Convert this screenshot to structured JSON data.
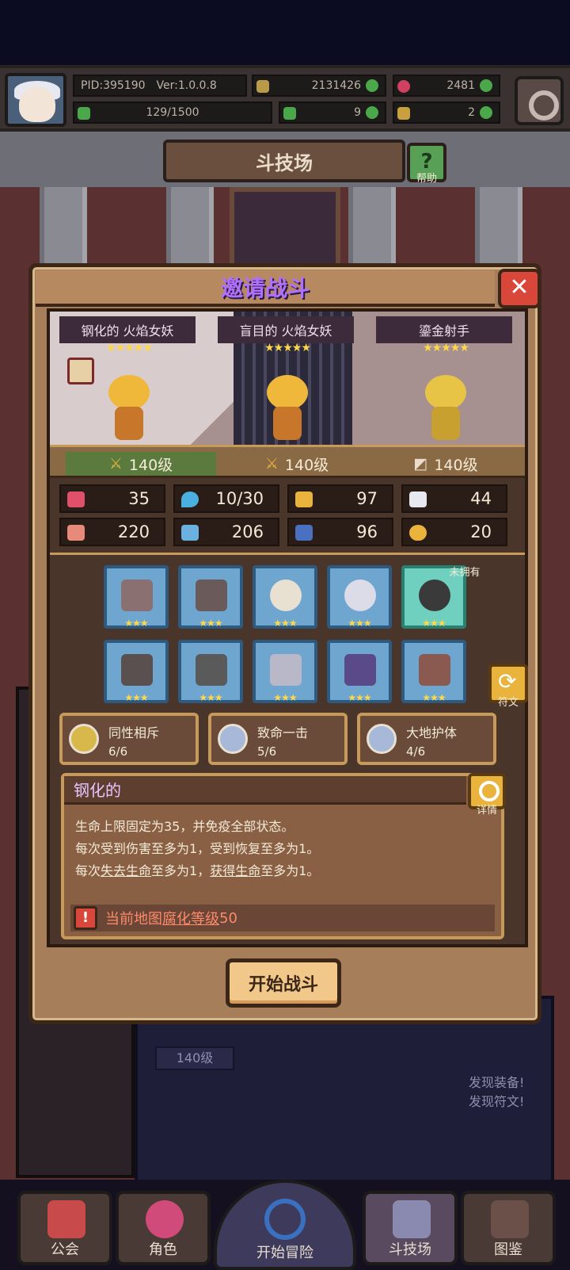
{
  "hud": {
    "pid": "PID:395190",
    "version": "Ver:1.0.0.8",
    "gold": "2131426",
    "gems": "2481",
    "stamina": "129/1500",
    "clover": "9",
    "keys": "2"
  },
  "arena": {
    "title": "斗技场",
    "help_label": "帮助"
  },
  "modal": {
    "title": "邀请战斗",
    "close": "✕",
    "heroes": [
      {
        "name": "钢化的 火焰女妖",
        "stars": "★★★★★",
        "level": "140级",
        "color": "#f0b83a"
      },
      {
        "name": "盲目的 火焰女妖",
        "stars": "★★★★★",
        "level": "140级",
        "color": "#f0b83a"
      },
      {
        "name": "鎏金射手",
        "stars": "★★★★★",
        "level": "140级",
        "color": "#e8c446"
      }
    ],
    "stats": [
      "35",
      "10/30",
      "97",
      "44",
      "220",
      "206",
      "96",
      "20"
    ],
    "unowned_label": "未拥有",
    "equip_stars": "★★★",
    "rune_label": "符文",
    "traits": [
      {
        "name": "同性相斥",
        "count": "6/6"
      },
      {
        "name": "致命一击",
        "count": "5/6"
      },
      {
        "name": "大地护体",
        "count": "4/6"
      }
    ],
    "desc": {
      "title": "钢化的",
      "detail_label": "详情",
      "line1": "生命上限固定为35，并免疫全部状态。",
      "line2": "每次受到伤害至多为1，受到恢复至多为1。",
      "line3a": "每次",
      "line3b": "失去生命",
      "line3c": "至多为1，",
      "line3d": "获得生命",
      "line3e": "至多为1。",
      "warn_a": "当前地图",
      "warn_b": "腐化等级",
      "warn_c": "50"
    },
    "start": "开始战斗"
  },
  "background": {
    "level": "140级",
    "hint1": "发现装备!",
    "hint2": "发现符文!"
  },
  "nav": [
    {
      "label": "公会"
    },
    {
      "label": "角色"
    },
    {
      "label": "开始冒险"
    },
    {
      "label": "斗技场"
    },
    {
      "label": "图鉴"
    }
  ]
}
